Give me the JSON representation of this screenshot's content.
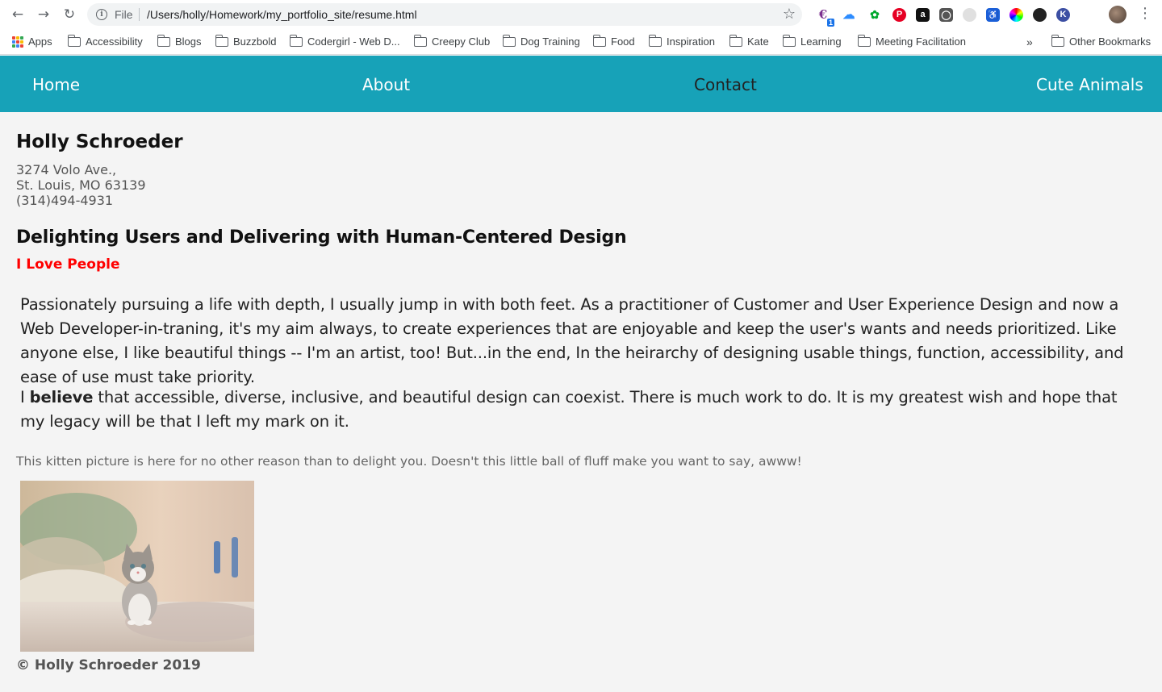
{
  "browser": {
    "file_label": "File",
    "url": "/Users/holly/Homework/my_portfolio_site/resume.html",
    "badge": "1",
    "bookmarks": {
      "apps": "Apps",
      "items": [
        "Accessibility",
        "Blogs",
        "Buzzbold",
        "Codergirl - Web D...",
        "Creepy Club",
        "Dog Training",
        "Food",
        "Inspiration",
        "Kate",
        "Learning",
        "Meeting Facilitation"
      ],
      "overflow": "»",
      "other": "Other Bookmarks"
    }
  },
  "nav": {
    "links": [
      "Home",
      "About",
      "Contact",
      "Cute Animals"
    ],
    "link_color": "#ffffff",
    "active_color": "#222222",
    "bar_color": "#17a2b8"
  },
  "profile": {
    "name": "Holly Schroeder",
    "address_line1": "3274 Volo Ave.,",
    "address_line2": "St. Louis, MO 63139",
    "phone": "(314)494-4931"
  },
  "headline": "Delighting Users and Delivering with Human-Centered Design",
  "tagline": "I Love People",
  "paragraph1": "Passionately pursuing a life with depth, I usually jump in with both feet. As a practitioner of Customer and User Experience Design and now a Web Developer-in-traning, it's my aim always, to create experiences that are enjoyable and keep the user's wants and needs prioritized. Like anyone else, I like beautiful things -- I'm an artist, too! But...in the end, In the heirarchy of designing usable things, function, accessibility, and ease of use must take priority.",
  "paragraph2": {
    "lead": "I ",
    "bold": "believe",
    "rest": " that accessible, diverse, inclusive, and beautiful design can coexist. There is much work to do. It is my greatest wish and hope that my legacy will be that I left my mark on it."
  },
  "caption": "This kitten picture is here for no other reason than to delight you. Doesn't this little ball of fluff make you want to say, awww!",
  "footer": "© Holly Schroeder 2019"
}
